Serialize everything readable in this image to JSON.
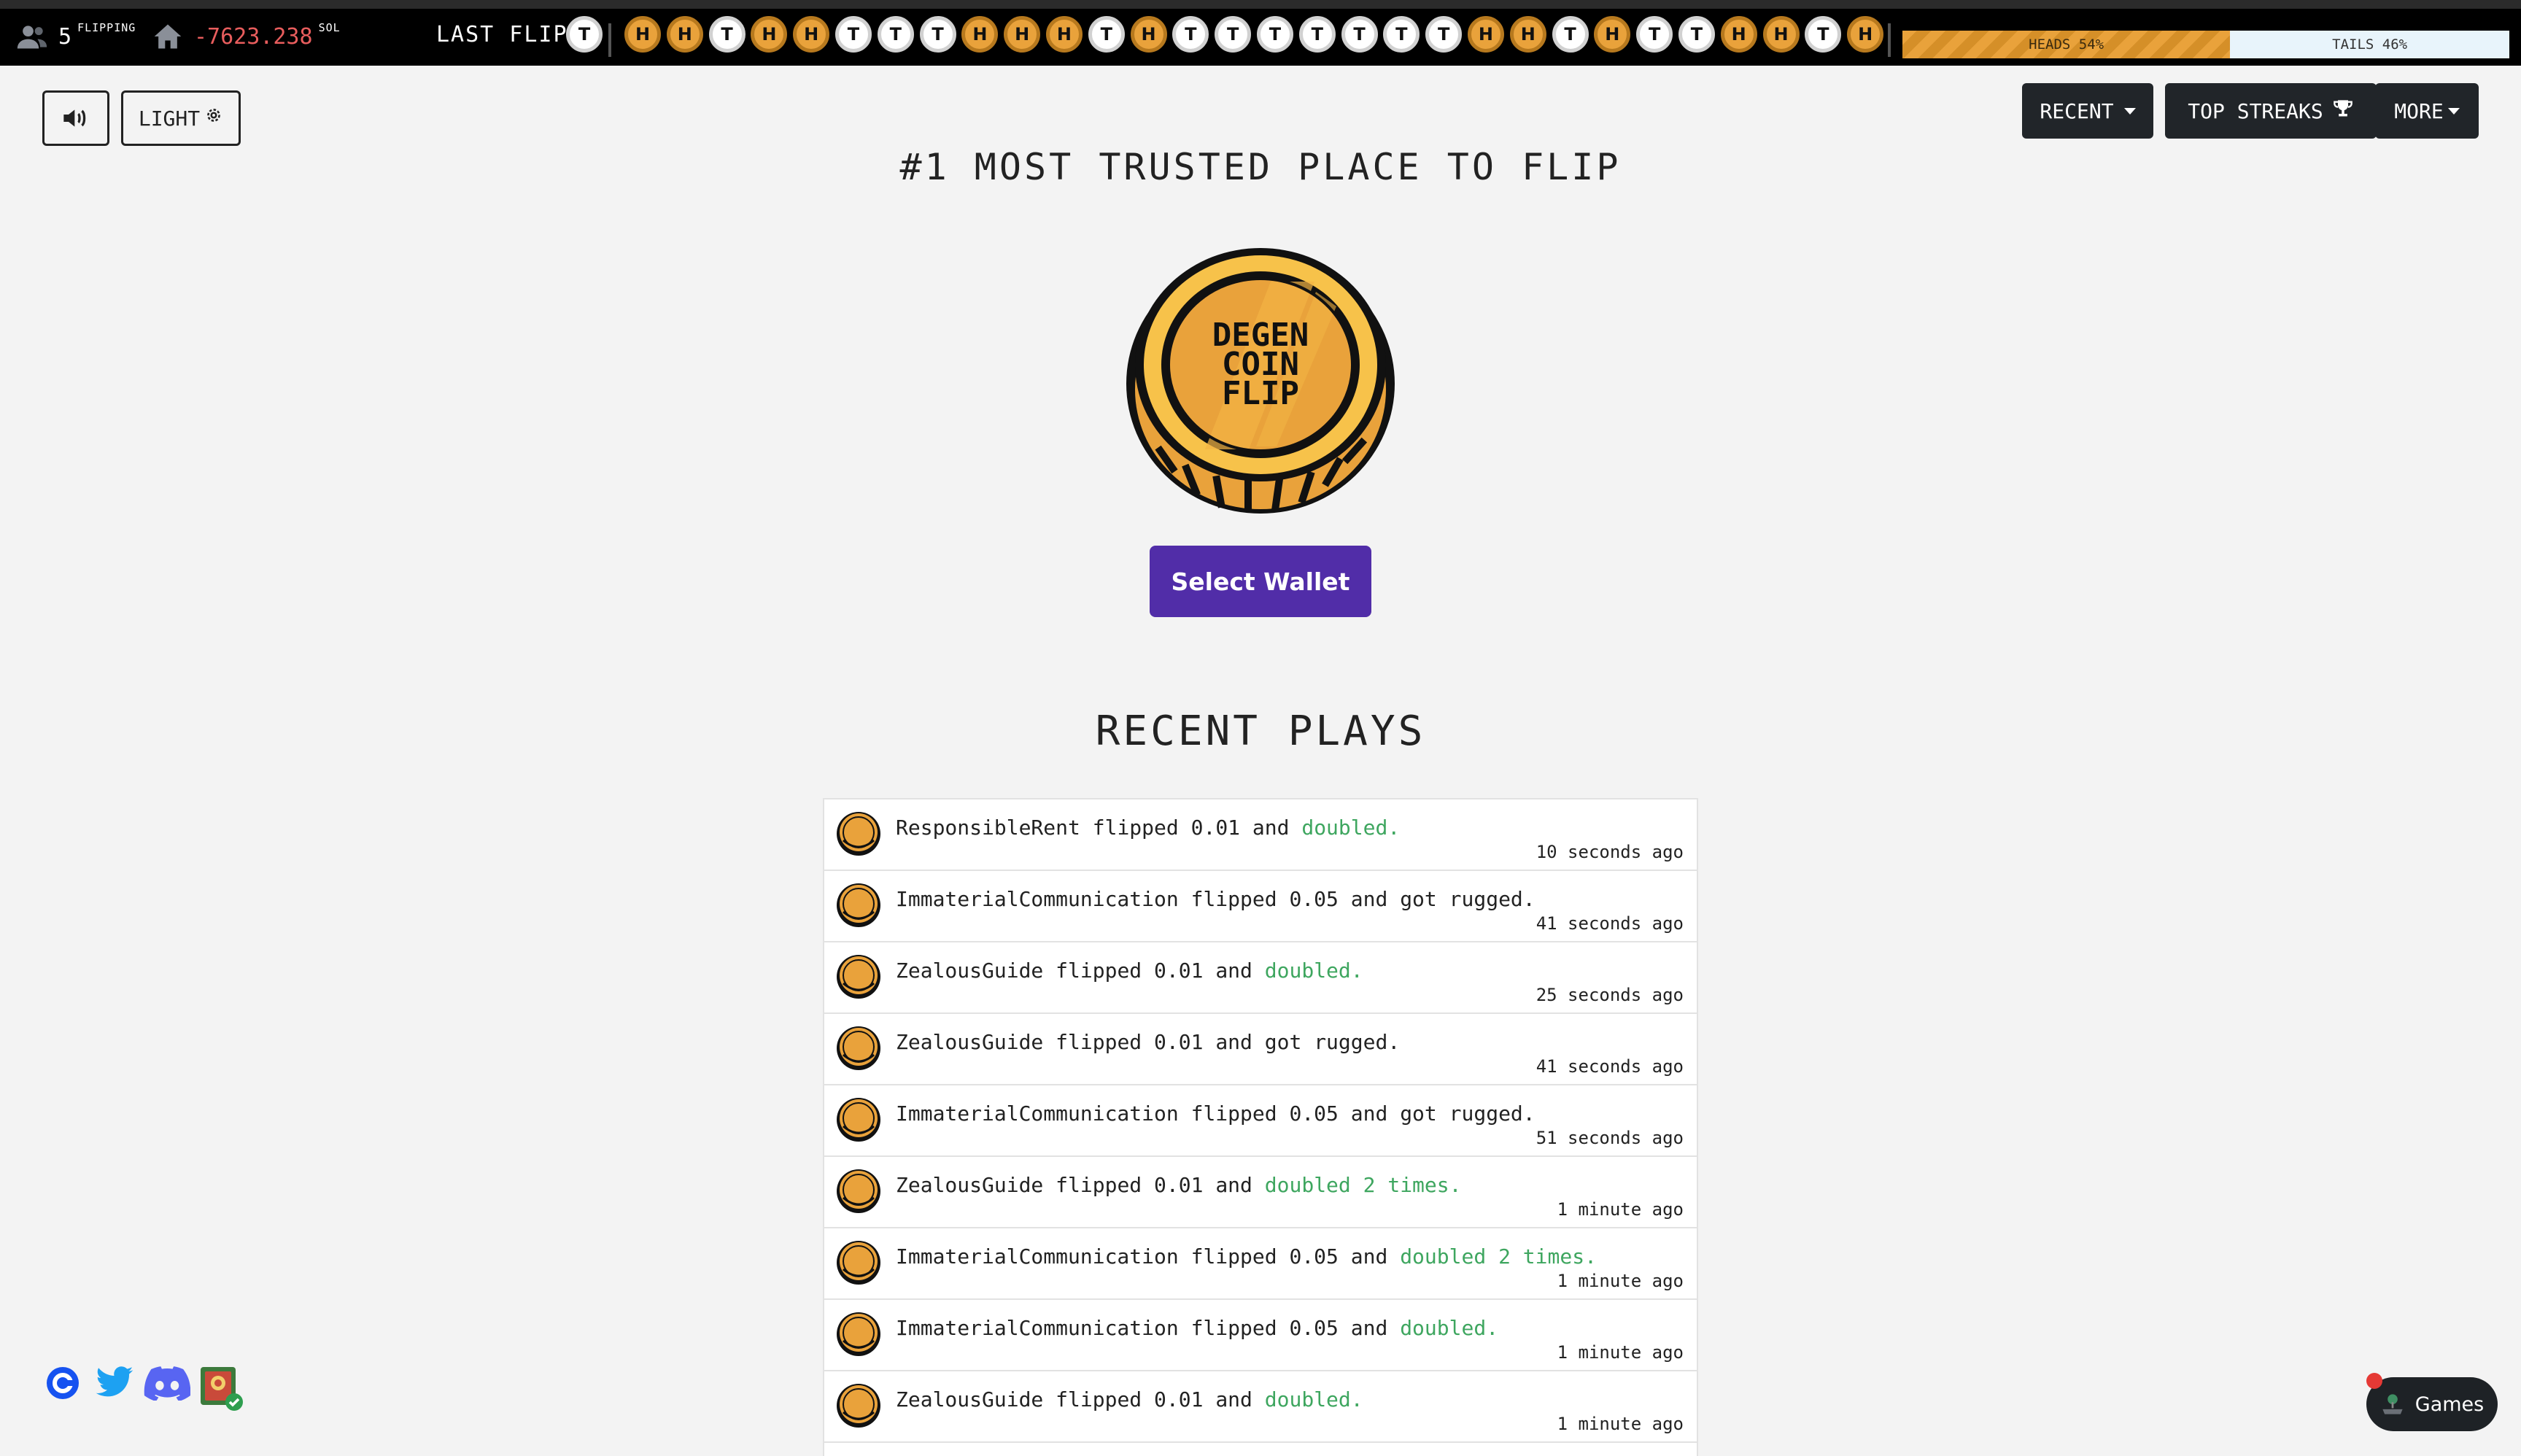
{
  "topbar": {
    "online_count": "5",
    "online_label": "FLIPPING",
    "house_value": "-7623.238",
    "house_unit": "SOL",
    "last_flips_label": "LAST FLIPS",
    "flips": [
      "T",
      "H",
      "H",
      "T",
      "H",
      "H",
      "T",
      "T",
      "T",
      "H",
      "H",
      "H",
      "T",
      "H",
      "T",
      "T",
      "T",
      "T",
      "T",
      "T",
      "T",
      "H",
      "H",
      "T",
      "H",
      "T",
      "T",
      "H",
      "H",
      "T",
      "H"
    ],
    "heads_label": "HEADS 54%",
    "tails_label": "TAILS 46%",
    "heads_fraction": 0.54
  },
  "controls": {
    "sound_icon": "volume-up-icon",
    "theme_label": "LIGHT",
    "theme_icon": "gear-icon"
  },
  "nav": {
    "recent_label": "RECENT",
    "top_streaks_label": "TOP STREAKS",
    "top_streaks_icon": "trophy-icon",
    "more_label": "MORE"
  },
  "hero": {
    "title": "#1 MOST TRUSTED PLACE TO FLIP",
    "coin_text": [
      "DEGEN",
      "COIN",
      "FLIP"
    ],
    "wallet_button": "Select Wallet"
  },
  "recent": {
    "title": "RECENT PLAYS",
    "plays": [
      {
        "user": "ResponsibleRent",
        "amount": "0.01",
        "outcome": "doubled.",
        "win": true,
        "time": "10 seconds ago"
      },
      {
        "user": "ImmaterialCommunication",
        "amount": "0.05",
        "outcome": "got rugged.",
        "win": false,
        "time": "41 seconds ago"
      },
      {
        "user": "ZealousGuide",
        "amount": "0.01",
        "outcome": "doubled.",
        "win": true,
        "time": "25 seconds ago"
      },
      {
        "user": "ZealousGuide",
        "amount": "0.01",
        "outcome": "got rugged.",
        "win": false,
        "time": "41 seconds ago"
      },
      {
        "user": "ImmaterialCommunication",
        "amount": "0.05",
        "outcome": "got rugged.",
        "win": false,
        "time": "51 seconds ago"
      },
      {
        "user": "ZealousGuide",
        "amount": "0.01",
        "outcome": "doubled 2 times.",
        "win": true,
        "time": "1 minute ago"
      },
      {
        "user": "ImmaterialCommunication",
        "amount": "0.05",
        "outcome": "doubled 2 times.",
        "win": true,
        "time": "1 minute ago"
      },
      {
        "user": "ImmaterialCommunication",
        "amount": "0.05",
        "outcome": "doubled.",
        "win": true,
        "time": "1 minute ago"
      },
      {
        "user": "ZealousGuide",
        "amount": "0.01",
        "outcome": "doubled.",
        "win": true,
        "time": "1 minute ago"
      }
    ],
    "flipped_word": "flipped",
    "and_word": "and"
  },
  "social": [
    "coinbase-icon",
    "twitter-icon",
    "discord-icon",
    "verified-shield-icon"
  ],
  "games_button": "Games",
  "colors": {
    "accent_gold": "#e9a23b",
    "wallet_purple": "#512da8",
    "win_green": "#3ea65f",
    "loss_red": "#e85d5d",
    "dark_button": "#212529"
  }
}
